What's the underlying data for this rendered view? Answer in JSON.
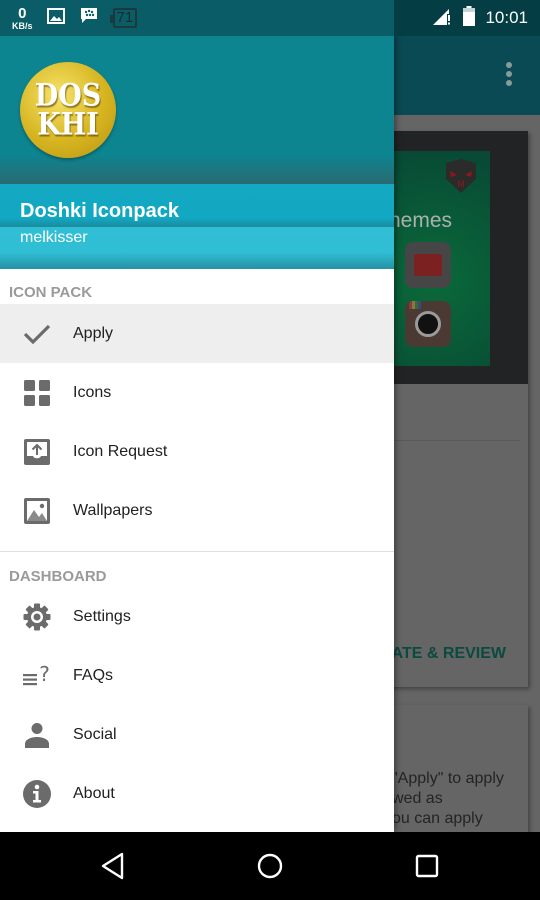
{
  "status_bar": {
    "net_speed_value": "0",
    "net_speed_unit": "KB/s",
    "notification_icons": [
      "image-icon",
      "blackberry-messenger-icon",
      "badge-71-icon"
    ],
    "badge_count": "71",
    "signal_icon": "signal-no-data-icon",
    "battery_icon": "battery-icon",
    "time": "10:01"
  },
  "drawer": {
    "header": {
      "logo_line1": "DOS",
      "logo_line2": "KHI",
      "app_name": "Doshki Iconpack",
      "user": "melkisser"
    },
    "sections": [
      {
        "label": "ICON PACK",
        "items": [
          {
            "label": "Apply",
            "icon": "check-icon",
            "active": true
          },
          {
            "label": "Icons",
            "icon": "grid-icon",
            "active": false
          },
          {
            "label": "Icon Request",
            "icon": "upload-icon",
            "active": false
          },
          {
            "label": "Wallpapers",
            "icon": "image-icon",
            "active": false
          }
        ]
      },
      {
        "label": "DASHBOARD",
        "items": [
          {
            "label": "Settings",
            "icon": "gear-icon",
            "active": false
          },
          {
            "label": "FAQs",
            "icon": "faq-icon",
            "active": false
          },
          {
            "label": "Social",
            "icon": "person-icon",
            "active": false
          },
          {
            "label": "About",
            "icon": "info-icon",
            "active": false
          }
        ]
      }
    ]
  },
  "background_app": {
    "preview_text": "hemes",
    "rate_review": "ATE & REVIEW",
    "card2_lines": [
      "\"Apply\" to apply",
      "wed as",
      "ou can apply"
    ]
  },
  "nav_bar": {
    "back": "back-icon",
    "home": "home-icon",
    "recents": "recents-icon"
  }
}
